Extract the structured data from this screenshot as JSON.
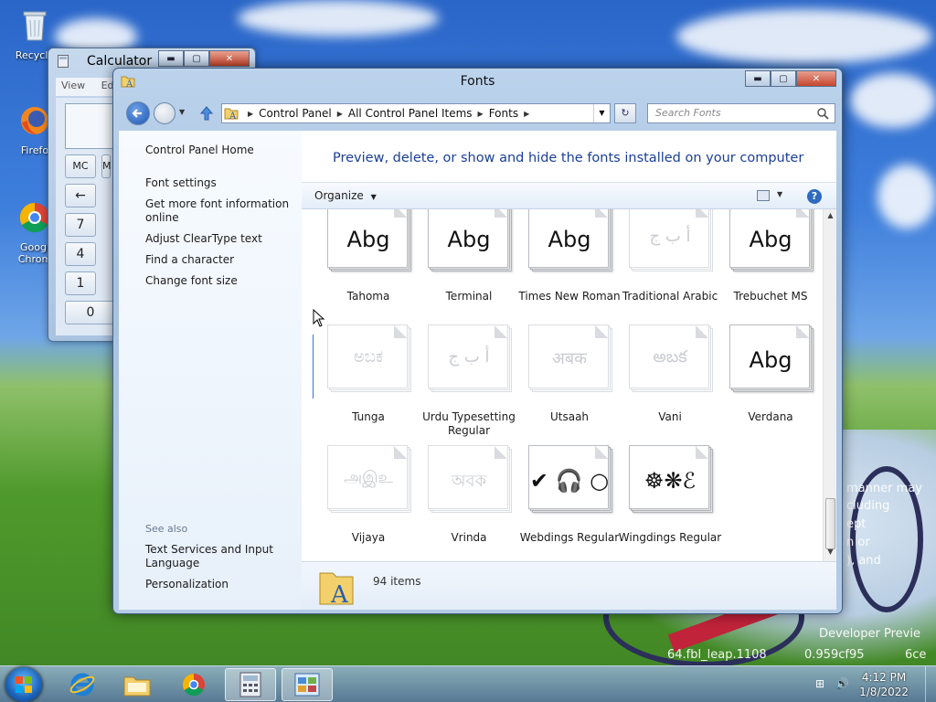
{
  "desktop": {
    "icons": [
      {
        "label": "Recycle"
      },
      {
        "label": "Firefo"
      },
      {
        "label": "Googl Chrom"
      }
    ],
    "watermark": {
      "lines": [
        "manner may",
        "cluding",
        "ept",
        "n or",
        "), and"
      ],
      "build_line_1": "Developer Previe",
      "build_line_2": "64.fbl_leap.1108",
      "build_line_3": "0.959cf95",
      "build_line_4": "6ce"
    }
  },
  "calculator": {
    "title": "Calculator",
    "menu": {
      "view": "View",
      "edit": "Edi"
    },
    "buttons": [
      "MC",
      "M",
      "←",
      "7",
      "4",
      "1",
      "0"
    ]
  },
  "fonts_window": {
    "title": "Fonts",
    "address": {
      "crumbs": [
        "Control Panel",
        "All Control Panel Items",
        "Fonts"
      ]
    },
    "search": {
      "placeholder": "Search Fonts"
    },
    "left_pane": {
      "links": [
        "Control Panel Home",
        "Font settings",
        "Get more font information online",
        "Adjust ClearType text",
        "Find a character",
        "Change font size"
      ],
      "see_also_heading": "See also",
      "see_also": [
        "Text Services and Input Language",
        "Personalization"
      ]
    },
    "main": {
      "title": "Preview, delete, or show and hide the fonts installed on your computer",
      "organize_label": "Organize",
      "help_glyph": "?"
    },
    "fonts": [
      {
        "name": "Tahoma",
        "sample": "Abg",
        "style": "normal"
      },
      {
        "name": "Terminal",
        "sample": "Abg",
        "style": "normal"
      },
      {
        "name": "Times New Roman",
        "sample": "Abg",
        "style": "normal"
      },
      {
        "name": "Traditional Arabic",
        "sample": "أ ب ج",
        "style": "faded"
      },
      {
        "name": "Trebuchet MS",
        "sample": "Abg",
        "style": "normal"
      },
      {
        "name": "Tunga",
        "sample": "ಅಬಕ",
        "style": "faded"
      },
      {
        "name": "Urdu Typesetting Regular",
        "sample": "أ ب ج",
        "style": "faded"
      },
      {
        "name": "Utsaah",
        "sample": "अबक",
        "style": "faded"
      },
      {
        "name": "Vani",
        "sample": "అబక",
        "style": "faded"
      },
      {
        "name": "Verdana",
        "sample": "Abg",
        "style": "normal"
      },
      {
        "name": "Vijaya",
        "sample": "அஇஉ",
        "style": "faded"
      },
      {
        "name": "Vrinda",
        "sample": "অবক",
        "style": "faded"
      },
      {
        "name": "Webdings Regular",
        "sample": "✔ 🎧 ○",
        "style": "normal"
      },
      {
        "name": "Wingdings Regular",
        "sample": "☸❋ℰ",
        "style": "normal"
      }
    ],
    "details": {
      "count": "94 items"
    }
  },
  "taskbar": {
    "items": [
      "Internet Explorer",
      "Windows Explorer",
      "Google Chrome",
      "Calculator",
      "Control Panel"
    ],
    "clock": {
      "time": "4:12 PM",
      "date": "1/8/2022"
    }
  },
  "colors": {
    "link": "#1a3f9a",
    "window_frame": "#bcd3ec"
  }
}
